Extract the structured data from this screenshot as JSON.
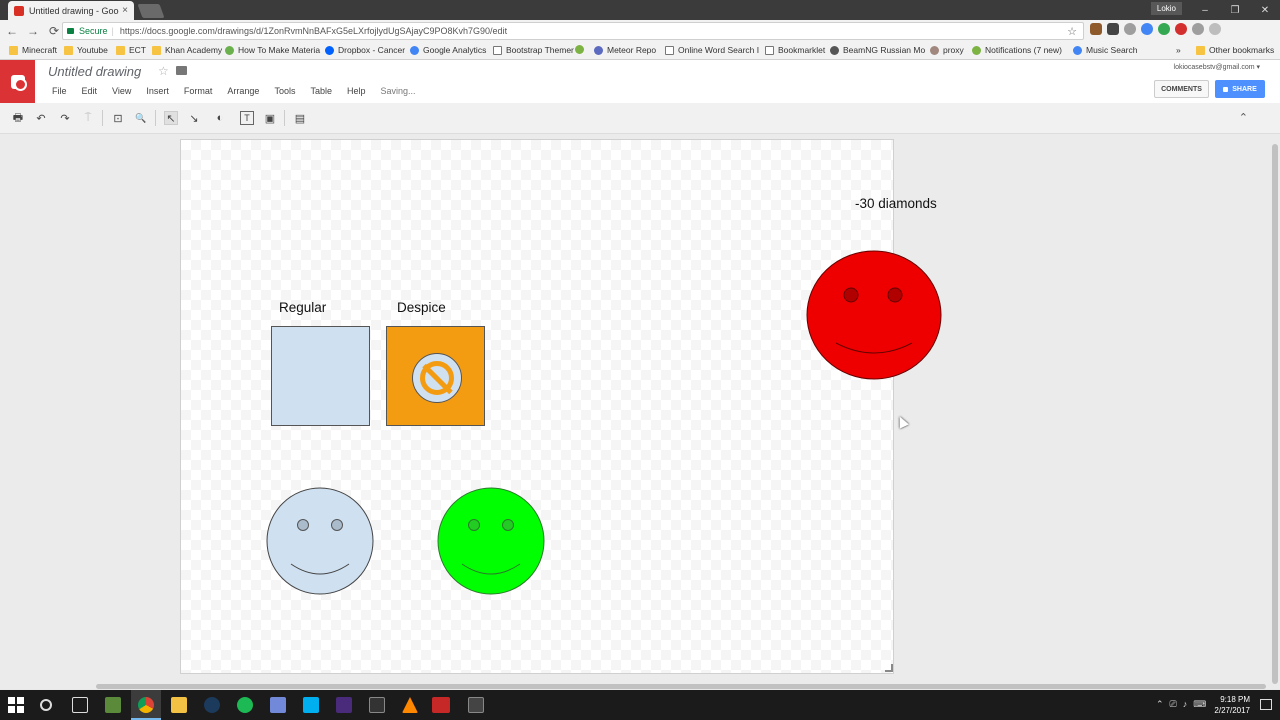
{
  "browser": {
    "tab_title": "Untitled drawing - Goog",
    "tab_close": "×",
    "user_badge": "Lokio",
    "window_controls": [
      "–",
      "❐",
      "✕"
    ],
    "nav": {
      "back": "←",
      "forward": "→",
      "reload": "⟳"
    },
    "secure_label": "Secure",
    "url": "https://docs.google.com/drawings/d/1ZonRvmNnBAFxG5eLXrfojlydUgSAjayC9PO8Kvh7G90/edit",
    "star": "☆",
    "extension_colors": [
      "#8e5a2b",
      "#444444",
      "#9e9e9e",
      "#4285f4",
      "#34a853",
      "#d32f2f",
      "#9e9e9e",
      "#bdbdbd"
    ]
  },
  "bookmarks": [
    {
      "label": "Minecraft",
      "icon": "folder"
    },
    {
      "label": "Youtube",
      "icon": "folder"
    },
    {
      "label": "ECT",
      "icon": "folder"
    },
    {
      "label": "Khan Academy",
      "icon": "folder"
    },
    {
      "label": "How To Make Materia",
      "icon": "green"
    },
    {
      "label": "Dropbox - Cancer",
      "icon": "blue"
    },
    {
      "label": "Google Analytics",
      "icon": "g"
    },
    {
      "label": "Bootstrap Themer",
      "icon": "page"
    },
    {
      "label": "",
      "icon": "leaf"
    },
    {
      "label": "Meteor Repo",
      "icon": "meteor"
    },
    {
      "label": "Online Word Search I",
      "icon": "page"
    },
    {
      "label": "Bookmarklet",
      "icon": "page"
    },
    {
      "label": "BeamNG Russian Mo",
      "icon": "beam"
    },
    {
      "label": "proxy",
      "icon": "proxy"
    },
    {
      "label": "Notifications (7 new)",
      "icon": "leaf"
    },
    {
      "label": "Music Search",
      "icon": "g"
    }
  ],
  "bookmarks_overflow": "»",
  "other_bookmarks": "Other bookmarks",
  "docs": {
    "title": "Untitled drawing",
    "title_star": "☆",
    "account": "lokiocasebstv@gmail.com ▾",
    "menu": [
      "File",
      "Edit",
      "View",
      "Insert",
      "Format",
      "Arrange",
      "Tools",
      "Table",
      "Help"
    ],
    "status": "Saving...",
    "comments_label": "COMMENTS",
    "share_label": "SHARE"
  },
  "toolbar": {
    "print": "🖶",
    "undo": "↶",
    "redo": "↷",
    "paint_format": "⍑",
    "zoom_fit": "⊡",
    "zoom": "🔍",
    "select": "↖",
    "line": "↘",
    "shape": "◐",
    "textbox": "T",
    "image": "▣",
    "comment": "▤",
    "collapse": "⌃"
  },
  "canvas": {
    "label_regular": "Regular",
    "label_despice": "Despice",
    "label_diamonds": "-30 diamonds",
    "colors": {
      "regular_fill": "#cfe0f1",
      "despice_fill": "#f39c12",
      "blue_face": "#cfe0f1",
      "green_face": "#00ff00",
      "red_face": "#ee0000"
    }
  },
  "taskbar": {
    "time": "9:18 PM",
    "date": "2/27/2017",
    "tray_icons": [
      "⌃",
      "⎚",
      "♪",
      "⌨"
    ]
  }
}
